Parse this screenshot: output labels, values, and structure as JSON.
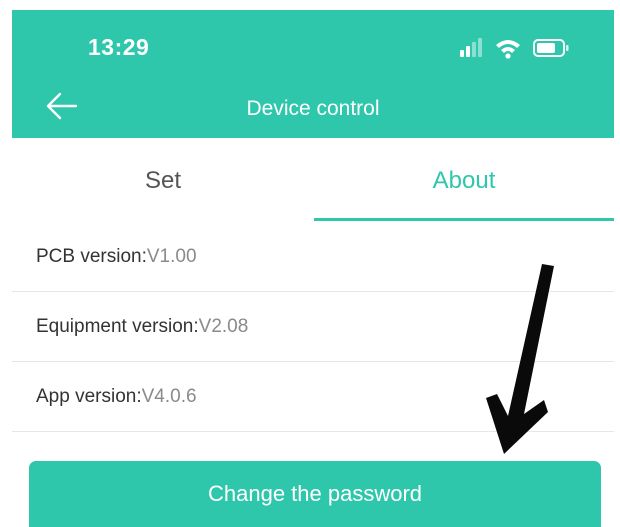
{
  "status_bar": {
    "time": "13:29",
    "icons": [
      "signal-icon",
      "wifi-icon",
      "battery-icon"
    ]
  },
  "nav": {
    "back_icon": "arrow-left-icon",
    "title": "Device control"
  },
  "tabs": [
    {
      "label": "Set",
      "active": false
    },
    {
      "label": "About",
      "active": true
    }
  ],
  "info": [
    {
      "label": "PCB version:",
      "value": "V1.00"
    },
    {
      "label": "Equipment version:",
      "value": "V2.08"
    },
    {
      "label": "App version:",
      "value": "V4.0.6"
    }
  ],
  "button": {
    "label": "Change the password"
  },
  "colors": {
    "accent": "#2ec7ac",
    "text_dark": "#333333",
    "text_muted": "#8a8a8a",
    "divider": "#e6e6e6"
  }
}
